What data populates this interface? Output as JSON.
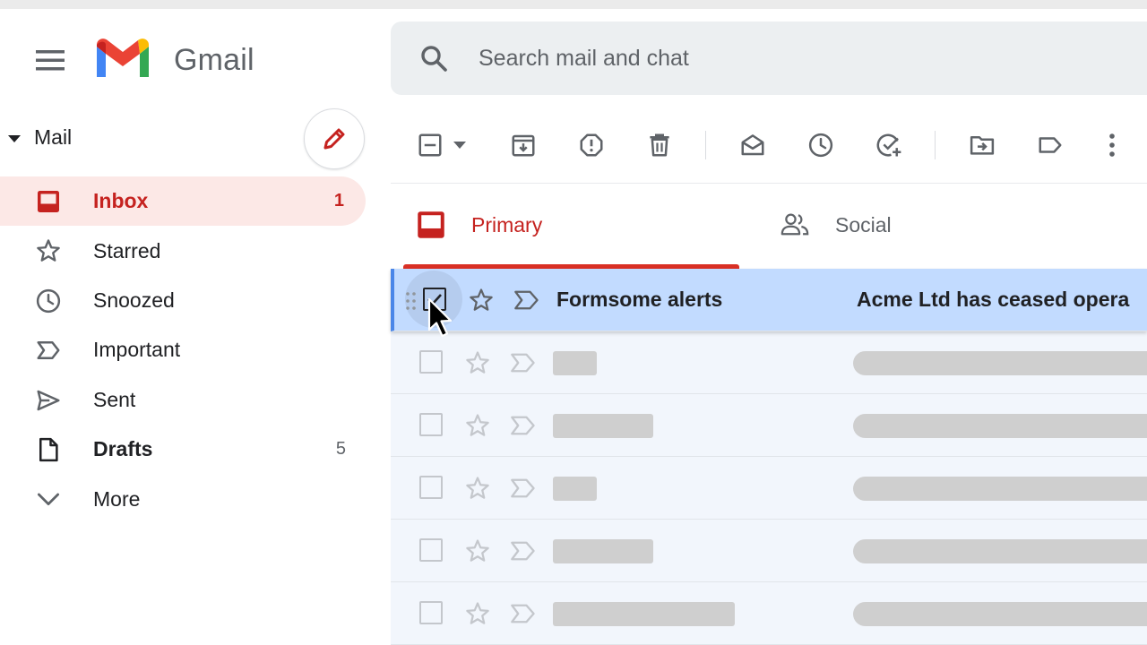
{
  "app": {
    "brand": "Gmail",
    "colors": {
      "accent_red": "#c5221f",
      "active_bg": "#fce8e6",
      "selected_row_bg": "#c2dbff",
      "unselected_row_bg": "#f2f6fc",
      "placeholder_gray": "#cfcfcf"
    }
  },
  "search": {
    "placeholder": "Search mail and chat",
    "icon": "search-icon"
  },
  "sidebar": {
    "section_label": "Mail",
    "compose_icon": "pencil-icon",
    "items": [
      {
        "label": "Inbox",
        "count": "1",
        "icon": "inbox-icon",
        "active": true
      },
      {
        "label": "Starred",
        "count": "",
        "icon": "star-icon"
      },
      {
        "label": "Snoozed",
        "count": "",
        "icon": "clock-icon"
      },
      {
        "label": "Important",
        "count": "",
        "icon": "important-icon"
      },
      {
        "label": "Sent",
        "count": "",
        "icon": "send-icon"
      },
      {
        "label": "Drafts",
        "count": "5",
        "icon": "draft-icon",
        "bold": true
      },
      {
        "label": "More",
        "count": "",
        "icon": "chevron-down-icon"
      }
    ]
  },
  "toolbar": {
    "icons": [
      "select-checkbox-icon",
      "dropdown-caret-icon",
      "archive-icon",
      "report-spam-icon",
      "delete-icon",
      "mark-read-icon",
      "snooze-icon",
      "add-task-icon",
      "move-to-icon",
      "label-icon",
      "more-vert-icon"
    ]
  },
  "tabs": [
    {
      "label": "Primary",
      "icon": "inbox-icon",
      "active": true
    },
    {
      "label": "Social",
      "icon": "people-icon"
    }
  ],
  "emails": [
    {
      "sender": "Formsome alerts",
      "subject": "Acme Ltd has ceased opera",
      "selected": true
    }
  ],
  "placeholder_rows": [
    {
      "sender_fraction": 0.15
    },
    {
      "sender_fraction": 0.34
    },
    {
      "sender_fraction": 0.15
    },
    {
      "sender_fraction": 0.34
    },
    {
      "sender_fraction": 0.62
    }
  ]
}
